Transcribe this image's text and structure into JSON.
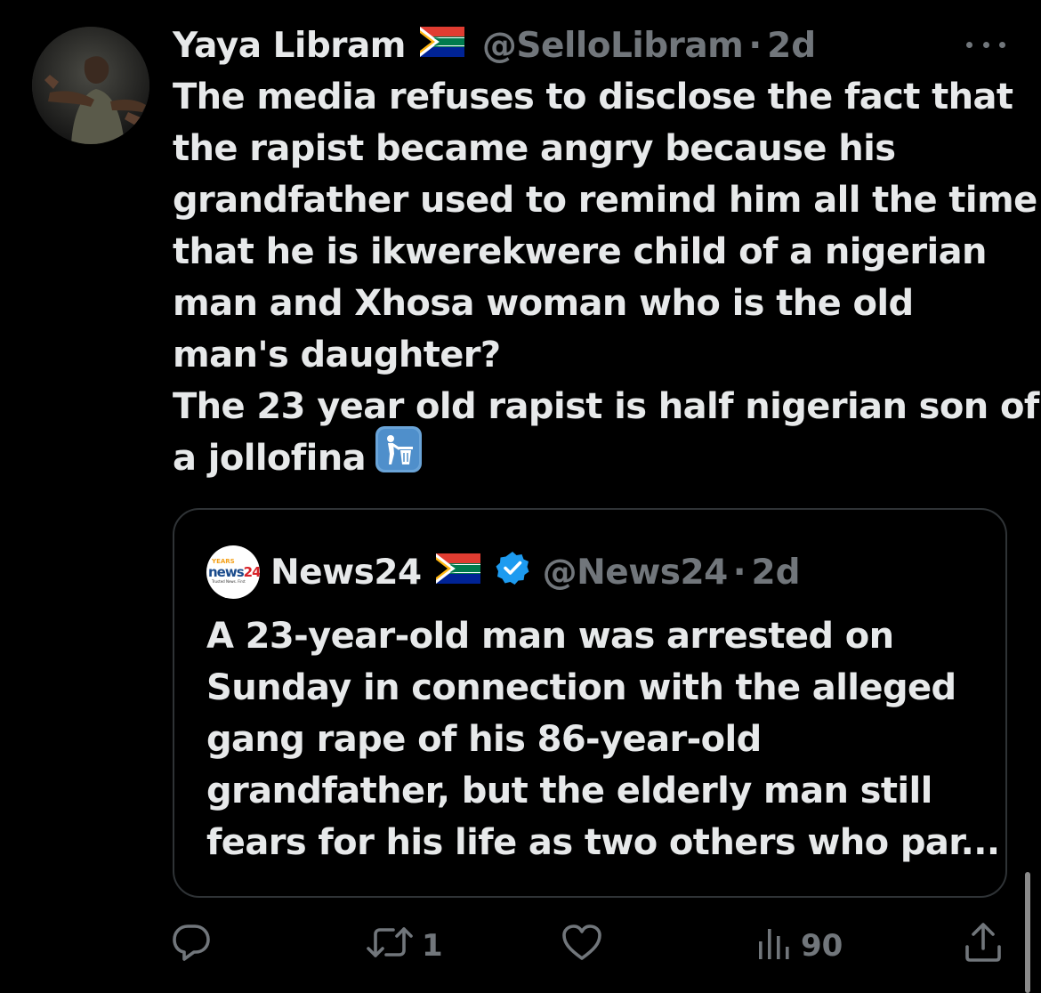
{
  "tweet": {
    "author": {
      "display_name": "Yaya Libram",
      "flag_icon": "south-africa-flag-icon",
      "handle": "@SelloLibram",
      "separator": "·",
      "time": "2d"
    },
    "text_lines": [
      "The media refuses to disclose the fact that",
      "the rapist became angry because his",
      "grandfather used to remind him all the time",
      "that he is ikwerekwere child of a nigerian",
      "man and Xhosa woman who is the old",
      "man's daughter?",
      "The 23 year old rapist is half nigerian son of",
      "a jollofina"
    ],
    "trailing_emoji": "litter-in-bin-icon"
  },
  "quote": {
    "author": {
      "display_name": "News24",
      "avatar_text_top": "YEARS",
      "avatar_brand": "news",
      "avatar_brand_number": "24",
      "avatar_tagline": "Trusted News. First",
      "handle": "@News24",
      "separator": "·",
      "time": "2d"
    },
    "text_lines": [
      "A 23-year-old man was arrested on",
      "Sunday in connection with the alleged",
      "gang rape of his 86-year-old",
      "grandfather, but the elderly man still",
      "fears for his life as two others who par..."
    ]
  },
  "actions": {
    "reply_icon": "reply-icon",
    "retweet_icon": "retweet-icon",
    "retweet_count": "1",
    "like_icon": "heart-icon",
    "views_icon": "views-chart-icon",
    "views_count": "90",
    "share_icon": "share-icon"
  },
  "colors": {
    "background": "#000000",
    "text": "#e7e9ea",
    "muted": "#71767b",
    "border": "#2f3336",
    "verified": "#1d9bf0"
  }
}
